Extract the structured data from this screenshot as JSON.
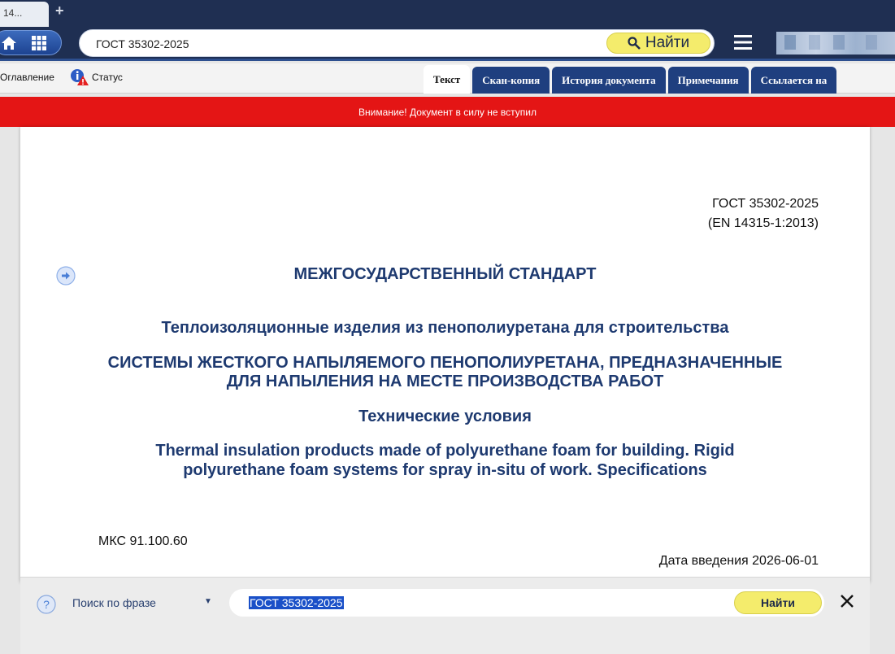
{
  "browser": {
    "tab_title": "14...",
    "new_tab_glyph": "+"
  },
  "toolbar": {
    "search_value": "ГОСТ 35302-2025",
    "find_label": "Найти",
    "icons": [
      "home-icon",
      "apps-grid-icon",
      "search-icon",
      "menu-icon"
    ]
  },
  "docbar": {
    "toc_label": "Оглавление",
    "status_label": "Статус",
    "tabs": [
      {
        "label": "Текст",
        "active": true
      },
      {
        "label": "Скан-копия",
        "active": false
      },
      {
        "label": "История документа",
        "active": false
      },
      {
        "label": "Примечания",
        "active": false
      },
      {
        "label": "Ссылается на",
        "active": false
      }
    ]
  },
  "alert": {
    "text": "Внимание! Документ в силу не вступил",
    "color": "#e41515"
  },
  "document": {
    "code": "ГОСТ 35302-2025",
    "en_code": "(EN 14315-1:2013)",
    "kind": "МЕЖГОСУДАРСТВЕННЫЙ СТАНДАРТ",
    "group": "Теплоизоляционные изделия из пенополиуретана для строительства",
    "title_line1": "СИСТЕМЫ ЖЕСТКОГО НАПЫЛЯЕМОГО ПЕНОПОЛИУРЕТАНА, ПРЕДНАЗНАЧЕННЫЕ",
    "title_line2": "ДЛЯ НАПЫЛЕНИЯ НА МЕСТЕ ПРОИЗВОДСТВА РАБОТ",
    "subtitle": "Технические условия",
    "en_title_line1": "Thermal insulation products made of polyurethane foam for building. Rigid",
    "en_title_line2": "polyurethane foam systems for spray in-situ of work. Specifications",
    "mks": "МКС 91.100.60",
    "intro_date": "Дата введения 2026-06-01"
  },
  "searchbar": {
    "mode_label": "Поиск по фразе",
    "query": "ГОСТ 35302-2025",
    "find_label": "Найти"
  },
  "colors": {
    "chrome": "#1f2f52",
    "tab_blue": "#1f3f7f",
    "title_blue": "#1e3a70",
    "find_yellow": "#f4ec6c"
  }
}
